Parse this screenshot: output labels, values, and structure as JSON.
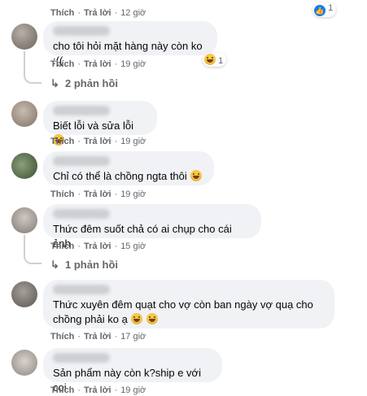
{
  "top": {
    "like_label": "Thích",
    "reply_label": "Trả lời",
    "time": "12 giờ",
    "reaction_count": "1"
  },
  "comments": [
    {
      "text": "cho tôi hỏi mặt hàng này còn ko :((",
      "like_label": "Thích",
      "reply_label": "Trả lời",
      "time": "19 giờ",
      "reaction_count": "1",
      "replies_label": "2 phản hồi"
    },
    {
      "text": "Biết lỗi và sửa lỗi",
      "like_label": "Thích",
      "reply_label": "Trả lời",
      "time": "19 giờ"
    },
    {
      "text": "Chỉ có thể là chồng ngta thôi",
      "like_label": "Thích",
      "reply_label": "Trả lời",
      "time": "19 giờ"
    },
    {
      "text": "Thức đêm suốt chả có ai chụp cho cái ảnh",
      "like_label": "Thích",
      "reply_label": "Trả lời",
      "time": "15 giờ",
      "replies_label": "1 phản hồi"
    },
    {
      "text_line1": "Thức xuyên đêm quạt cho vợ còn ban ngày vợ quạ cho",
      "text_line2": "chồng phải ko ạ",
      "like_label": "Thích",
      "reply_label": "Trả lời",
      "time": "17 giờ"
    },
    {
      "text": "Sản phẩm này còn k?ship e với coi",
      "like_label": "Thích",
      "reply_label": "Trả lời",
      "time": "19 giờ"
    }
  ],
  "separator": "·",
  "icons": {
    "like": "like-icon",
    "emoji": "laughing-emoji-icon",
    "reply_arrow": "reply-arrow-icon"
  }
}
